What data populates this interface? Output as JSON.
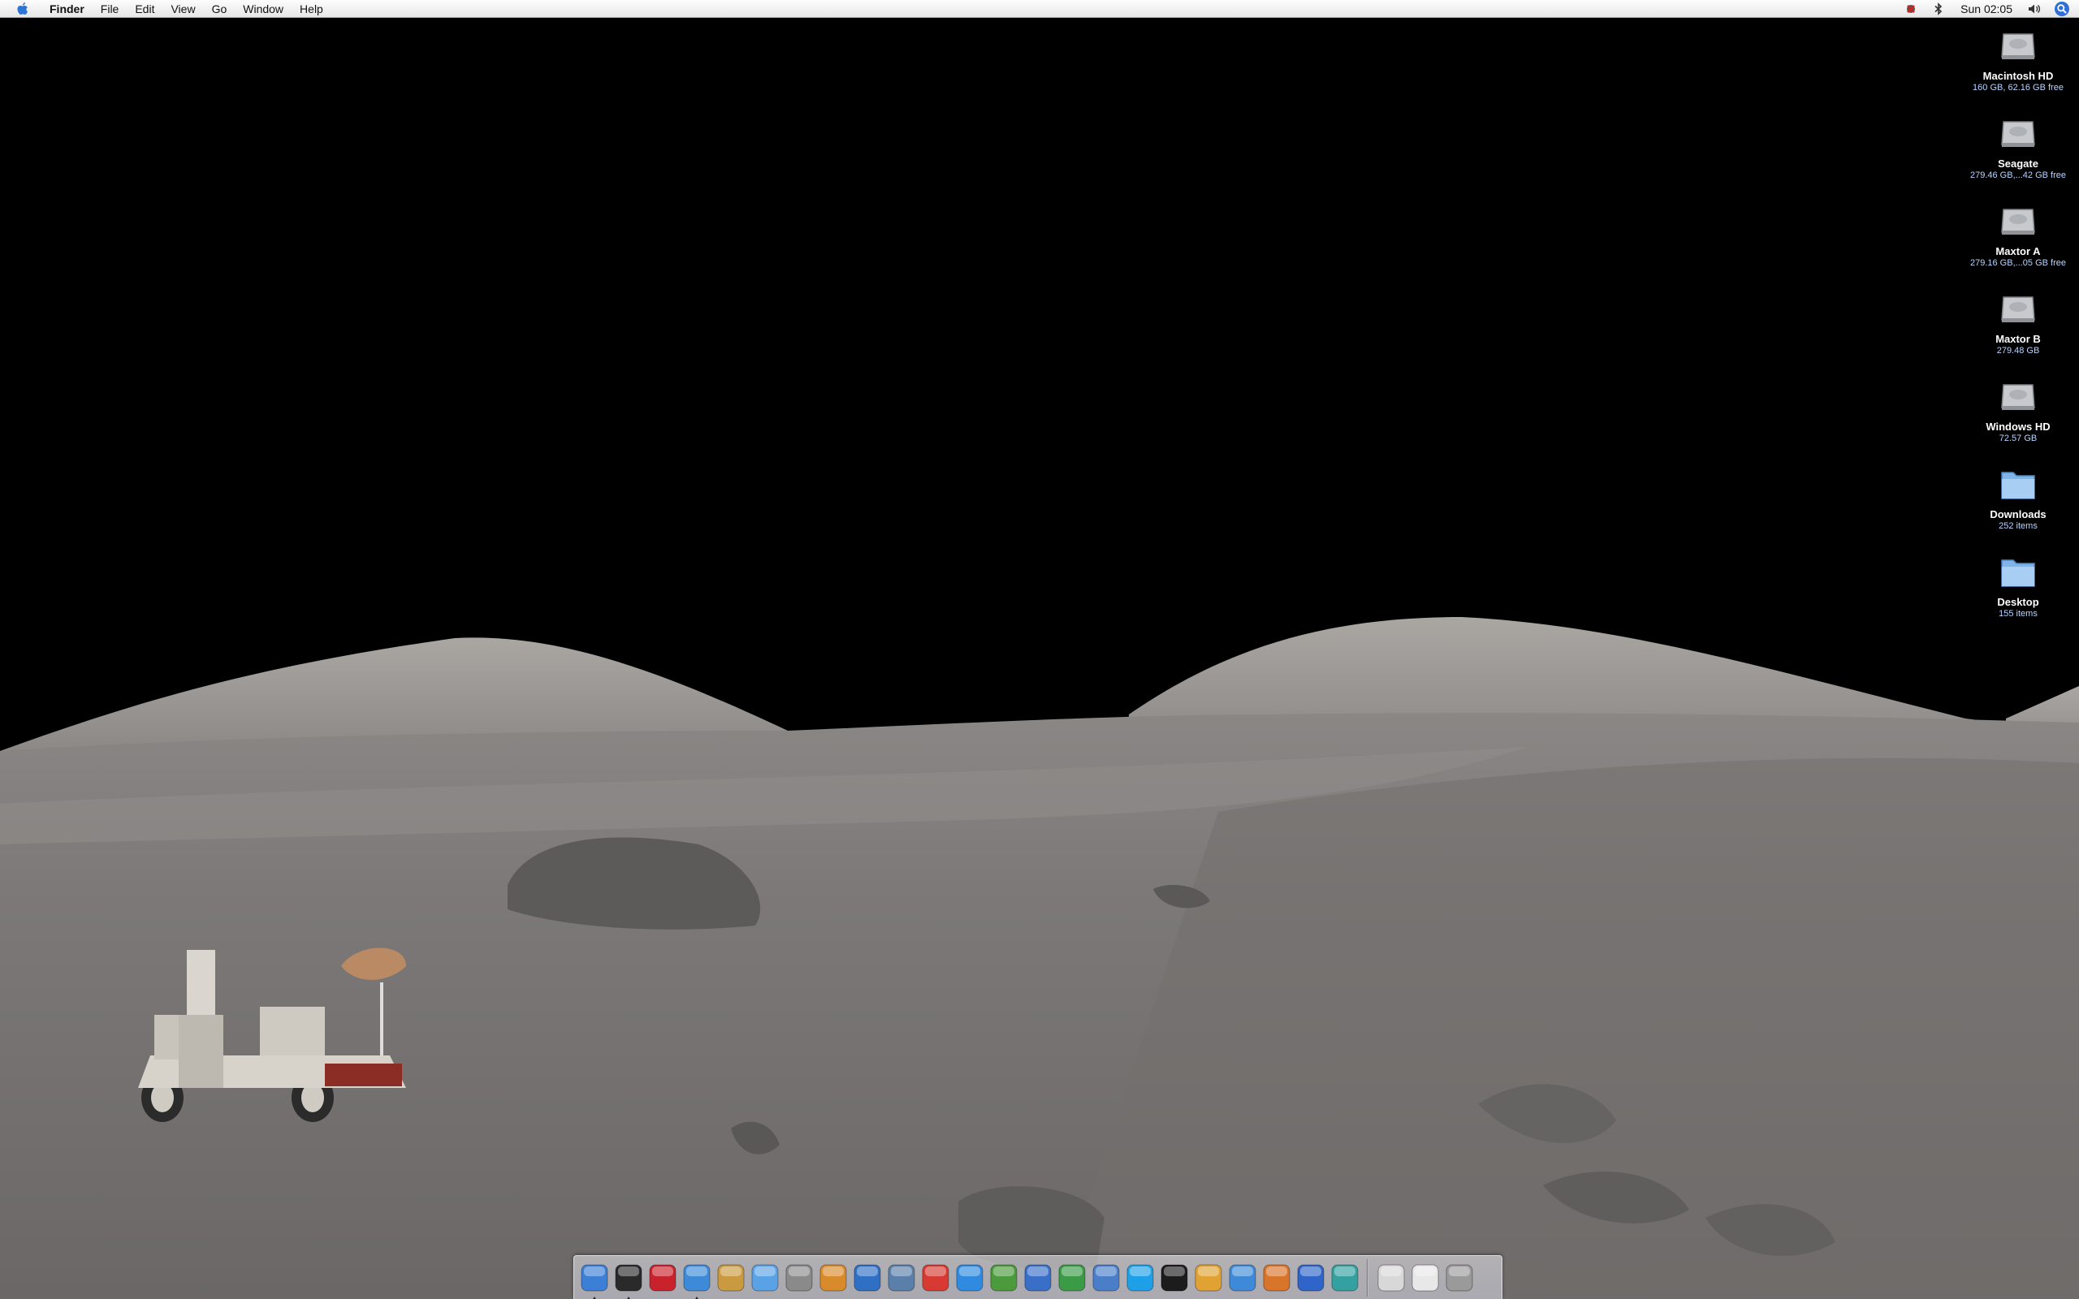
{
  "menubar": {
    "app_name": "Finder",
    "items": [
      "File",
      "Edit",
      "View",
      "Go",
      "Window",
      "Help"
    ],
    "clock": "Sun 02:05"
  },
  "desktop_icons": [
    {
      "name": "Macintosh HD",
      "info": "160 GB, 62.16 GB free",
      "kind": "hard-drive-icon"
    },
    {
      "name": "Seagate",
      "info": "279.46 GB,...42 GB free",
      "kind": "hard-drive-icon"
    },
    {
      "name": "Maxtor A",
      "info": "279.16 GB,...05 GB free",
      "kind": "hard-drive-icon"
    },
    {
      "name": "Maxtor B",
      "info": "279.48 GB",
      "kind": "hard-drive-icon"
    },
    {
      "name": "Windows HD",
      "info": "72.57 GB",
      "kind": "hard-drive-icon"
    },
    {
      "name": "Downloads",
      "info": "252 items",
      "kind": "folder-icon"
    },
    {
      "name": "Desktop",
      "info": "155 items",
      "kind": "folder-icon"
    }
  ],
  "dock": {
    "apps": [
      {
        "icon": "finder-icon",
        "color": "#3b7fd6",
        "running": true
      },
      {
        "icon": "dashboard-icon",
        "color": "#2a2a2a",
        "running": true
      },
      {
        "icon": "yahoo-widgets-icon",
        "color": "#c8232c",
        "running": false
      },
      {
        "icon": "safari-compass-icon",
        "color": "#3d8ad8",
        "running": true
      },
      {
        "icon": "address-book-icon",
        "color": "#c99a3f",
        "running": false
      },
      {
        "icon": "itunes-icon",
        "color": "#5aa2e6",
        "running": false
      },
      {
        "icon": "sync-icon",
        "color": "#8a8a8a",
        "running": false
      },
      {
        "icon": "iphoto-icon",
        "color": "#d98a2b",
        "running": false
      },
      {
        "icon": "imovie-icon",
        "color": "#2f6fc4",
        "running": false
      },
      {
        "icon": "preview-icon",
        "color": "#5a7fa8",
        "running": false
      },
      {
        "icon": "ical-icon",
        "color": "#d63a32",
        "running": false
      },
      {
        "icon": "quicktime-icon",
        "color": "#2f8ae0",
        "running": false
      },
      {
        "icon": "x11-icon",
        "color": "#4b9a3c",
        "running": false
      },
      {
        "icon": "word-icon",
        "color": "#3a6fc8",
        "running": false
      },
      {
        "icon": "excel-icon",
        "color": "#3a9a46",
        "running": false
      },
      {
        "icon": "xcode-icon",
        "color": "#4a7ec8",
        "running": false
      },
      {
        "icon": "skype-icon",
        "color": "#1ea0e8",
        "running": false
      },
      {
        "icon": "terminal-icon",
        "color": "#1c1c1c",
        "running": false
      },
      {
        "icon": "adium-icon",
        "color": "#e0a232",
        "running": false
      },
      {
        "icon": "ichat-icon",
        "color": "#3e8ad8",
        "running": false
      },
      {
        "icon": "matlab-icon",
        "color": "#d9742b",
        "running": false
      },
      {
        "icon": "bird-app-icon",
        "color": "#2f64c8",
        "running": false
      },
      {
        "icon": "quill-app-icon",
        "color": "#35a0a0",
        "running": false
      }
    ],
    "right": [
      {
        "icon": "document-stack-icon",
        "color": "#d8d8d8"
      },
      {
        "icon": "document-stack-2-icon",
        "color": "#e8e8e8"
      },
      {
        "icon": "trash-icon",
        "color": "#9a9a9a"
      }
    ]
  }
}
